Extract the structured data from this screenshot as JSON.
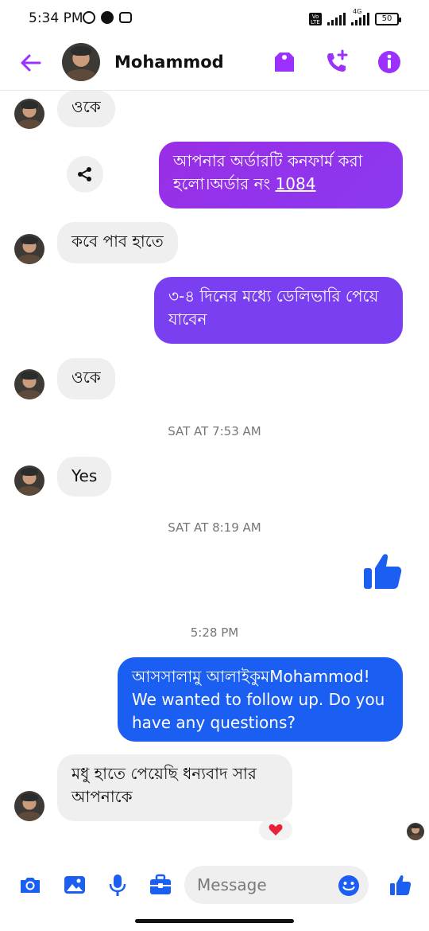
{
  "status_bar": {
    "time": "5:34 PM",
    "volte": "Vo LTE",
    "network": "4G",
    "battery": "50"
  },
  "header": {
    "contact_name": "Mohammod",
    "accent_color": "#9b30ff",
    "icons": [
      "back-arrow-icon",
      "tag-icon",
      "add-call-icon",
      "info-icon"
    ]
  },
  "messages": {
    "m1": "ওকে",
    "m2_text": "আপনার অর্ডারটি  কনফার্ম করা হলো।অর্ডার নং ",
    "m2_order": "1084",
    "m3": "কবে পাব হাতে",
    "m4": "৩-৪ দিনের মধ্যে ডেলিভারি পেয়ে যাবেন",
    "m5": "ওকে",
    "ts1": "SAT AT 7:53 AM",
    "m6": "Yes",
    "ts2": "SAT AT 8:19 AM",
    "ts3": "5:28 PM",
    "m7": "আসসালামু আলাইকুমMohammod! We wanted to follow up. Do you have any questions?",
    "m8": "মধু  হাতে পেয়েছি ধন্যবাদ  সার আপনাকে",
    "reaction": "❤️"
  },
  "composer": {
    "placeholder": "Message",
    "icons": [
      "camera-icon",
      "gallery-icon",
      "microphone-icon",
      "briefcase-icon",
      "emoji-icon",
      "like-icon"
    ]
  },
  "colors": {
    "purple": "#9a2ee6",
    "violet": "#7a3ff0",
    "blue": "#1a5ef2",
    "incoming": "#efefef"
  }
}
